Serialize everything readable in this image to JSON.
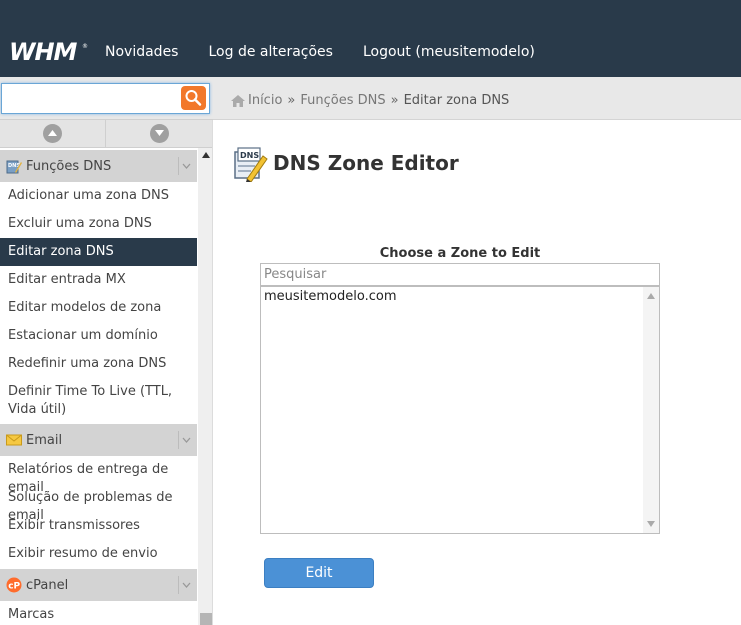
{
  "app": {
    "logo_text": "WHM",
    "nav": [
      "Novidades",
      "Log de alterações",
      "Logout (meusitemodelo)"
    ]
  },
  "search": {
    "value": "",
    "placeholder": ""
  },
  "breadcrumb": {
    "home": "Início",
    "section": "Funções DNS",
    "current": "Editar zona DNS",
    "separator": "»"
  },
  "sidebar": {
    "groups": [
      {
        "title": "Funções DNS",
        "icon": "dns-icon",
        "items": [
          "Adicionar uma zona DNS",
          "Excluir uma zona DNS",
          "Editar zona DNS",
          "Editar entrada MX",
          "Editar modelos de zona",
          "Estacionar um domínio",
          "Redefinir uma zona DNS",
          "Definir Time To Live (TTL, Vida útil)"
        ],
        "active": "Editar zona DNS"
      },
      {
        "title": "Email",
        "icon": "envelope-icon",
        "items": [
          "Relatórios de entrega de email",
          "Solução de problemas de email",
          "Exibir transmissores",
          "Exibir resumo de envio"
        ]
      },
      {
        "title": "cPanel",
        "icon": "cpanel-icon",
        "items": [
          "Marcas"
        ]
      }
    ]
  },
  "main": {
    "title": "DNS Zone Editor",
    "icon_text": "DNS",
    "zone_label": "Choose a Zone to Edit",
    "zone_search_placeholder": "Pesquisar",
    "zones": [
      "meusitemodelo.com"
    ],
    "edit_button": "Edit"
  },
  "colors": {
    "topbar": "#293a4a",
    "active_item": "#293a4a",
    "search_button": "#f2782b",
    "edit_button": "#4b91d6"
  }
}
